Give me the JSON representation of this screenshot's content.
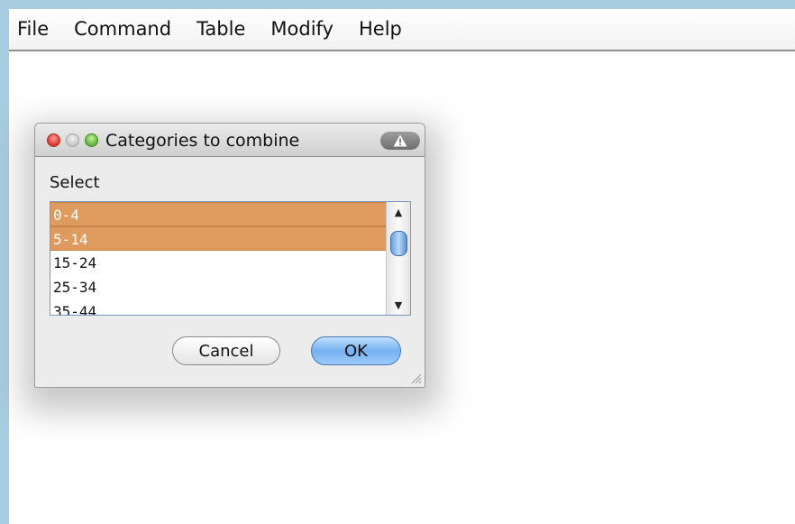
{
  "menubar": {
    "items": [
      "File",
      "Command",
      "Table",
      "Modify",
      "Help"
    ]
  },
  "dialog": {
    "title": "Categories to combine",
    "select_label": "Select",
    "list": {
      "items": [
        {
          "label": "0-4",
          "selected": true
        },
        {
          "label": "5-14",
          "selected": true
        },
        {
          "label": "15-24",
          "selected": false
        },
        {
          "label": "25-34",
          "selected": false
        },
        {
          "label": "35-44",
          "selected": false
        }
      ]
    },
    "cancel_label": "Cancel",
    "ok_label": "OK"
  },
  "colors": {
    "selection": "#df9b5e",
    "window_frame": "#a9cde0",
    "ok_button": "#76b0ee"
  },
  "icons": {
    "close": "close-traffic-light-icon",
    "minimize": "minimize-traffic-light-icon",
    "zoom": "zoom-traffic-light-icon",
    "alert": "warning-icon",
    "scroll_up": "scroll-up-arrow-icon",
    "scroll_down": "scroll-down-arrow-icon",
    "resize": "resize-grip-icon"
  }
}
